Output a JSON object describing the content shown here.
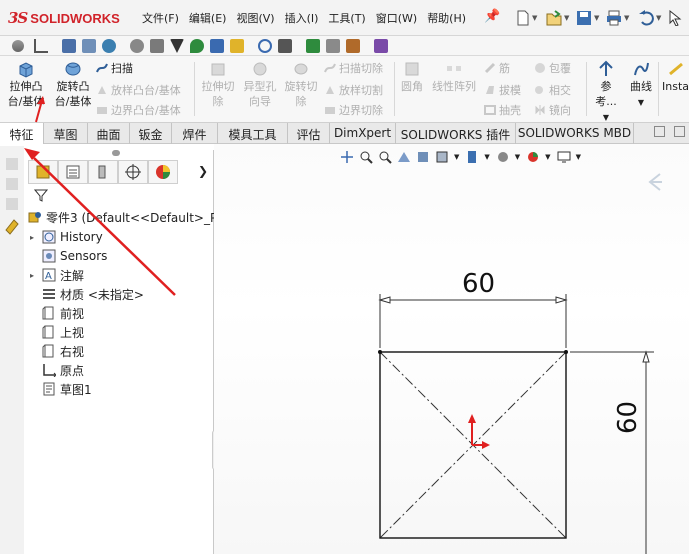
{
  "app": {
    "logo_prefix": "3S",
    "logo_name": "SOLIDWORKS"
  },
  "menu": [
    {
      "label": "文件(F)"
    },
    {
      "label": "编辑(E)"
    },
    {
      "label": "视图(V)"
    },
    {
      "label": "插入(I)"
    },
    {
      "label": "工具(T)"
    },
    {
      "label": "窗口(W)"
    },
    {
      "label": "帮助(H)"
    }
  ],
  "command_manager": {
    "extrude_boss_line1": "拉伸凸",
    "extrude_boss_line2": "台/基体",
    "revolve_boss_line1": "旋转凸",
    "revolve_boss_line2": "台/基体",
    "sweep": "扫描",
    "loft": "放样凸台/基体",
    "boundary": "边界凸台/基体",
    "extrude_cut_line1": "拉伸切",
    "extrude_cut_line2": "除",
    "hole_wizard_line1": "异型孔",
    "hole_wizard_line2": "向导",
    "revolve_cut_line1": "旋转切",
    "revolve_cut_line2": "除",
    "swept_cut": "扫描切除",
    "lofted_cut": "放样切割",
    "boundary_cut": "边界切除",
    "fillet": "圆角",
    "linear_pattern": "线性阵列",
    "rib": "筋",
    "draft": "拔模",
    "shell": "抽壳",
    "wrap": "包覆",
    "intersect": "相交",
    "mirror": "镜向",
    "reference": "参考...",
    "curves": "曲线",
    "instant3d": "Insta"
  },
  "tabs": [
    {
      "label": "特征",
      "active": true
    },
    {
      "label": "草图"
    },
    {
      "label": "曲面"
    },
    {
      "label": "钣金"
    },
    {
      "label": "焊件"
    },
    {
      "label": "模具工具"
    },
    {
      "label": "评估"
    },
    {
      "label": "DimXpert"
    },
    {
      "label": "SOLIDWORKS 插件"
    },
    {
      "label": "SOLIDWORKS MBD"
    }
  ],
  "feature_tree": {
    "part": "零件3  (Default<<Default>_Ph",
    "items": [
      {
        "label": "History",
        "expandable": true
      },
      {
        "label": "Sensors",
        "expandable": false
      },
      {
        "label": "注解",
        "expandable": true
      },
      {
        "label": "材质 <未指定>",
        "expandable": false
      },
      {
        "label": "前视",
        "expandable": false
      },
      {
        "label": "上视",
        "expandable": false
      },
      {
        "label": "右视",
        "expandable": false
      },
      {
        "label": "原点",
        "expandable": false
      },
      {
        "label": "草图1",
        "expandable": false
      }
    ]
  },
  "sketch": {
    "width_dimension": "60",
    "height_dimension": "60"
  },
  "colors": {
    "brand_red": "#d1232a",
    "annotation_arrow": "#e02020",
    "sketch_line": "#111111"
  },
  "icons": {
    "fm_tabs": [
      "feature-manager-icon",
      "property-manager-icon",
      "configuration-manager-icon",
      "dimxpert-manager-icon",
      "display-manager-icon"
    ]
  }
}
